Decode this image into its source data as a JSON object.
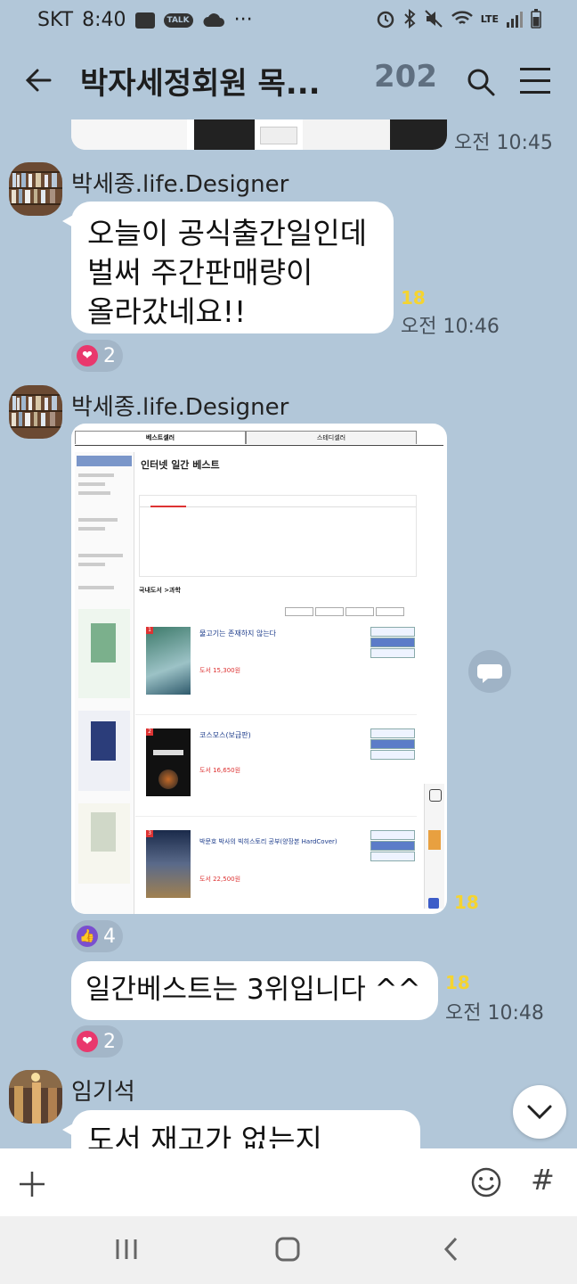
{
  "status_bar": {
    "carrier": "SKT",
    "time": "8:40",
    "talk_badge": "TALK",
    "more": "···",
    "lte": "LTE"
  },
  "header": {
    "title": "박자세정회원 목...",
    "member_count": "202"
  },
  "messages": [
    {
      "time": "오전 10:45"
    },
    {
      "sender": "박세종.life.Designer",
      "lines": [
        "오늘이 공식출간일인데",
        "벌써 주간판매량이",
        "올라갔네요!!"
      ],
      "unread": "18",
      "time": "오전 10:46",
      "reaction_count": "2"
    },
    {
      "sender": "박세종.life.Designer",
      "image": {
        "tabs": [
          "베스트셀러",
          "스테디셀러"
        ],
        "heading": "인터넷 일간 베스트",
        "category_path": "국내도서 >과학",
        "books": [
          {
            "rank": "1",
            "title": "물고기는 존재하지 않는다",
            "price": "도서 15,300원"
          },
          {
            "rank": "2",
            "title": "코스모스(보급판)",
            "price": "도서 16,650원"
          },
          {
            "rank": "3",
            "title": "박문호 박사의 빅히스토리 공부(양장본 HardCover)",
            "price": "도서 22,500원"
          }
        ]
      },
      "unread": "18",
      "reaction_count": "4"
    },
    {
      "text": "일간베스트는 3위입니다 ^^",
      "unread": "18",
      "time": "오전 10:48",
      "reaction_count": "2"
    },
    {
      "sender": "임기석",
      "text": "도서 재고가 없는지"
    }
  ],
  "input_bar": {
    "hash": "#"
  },
  "colors": {
    "background": "#b2c7d9",
    "unread": "#f5d430",
    "heart": "#e9386d",
    "like": "#7a4fcf"
  }
}
